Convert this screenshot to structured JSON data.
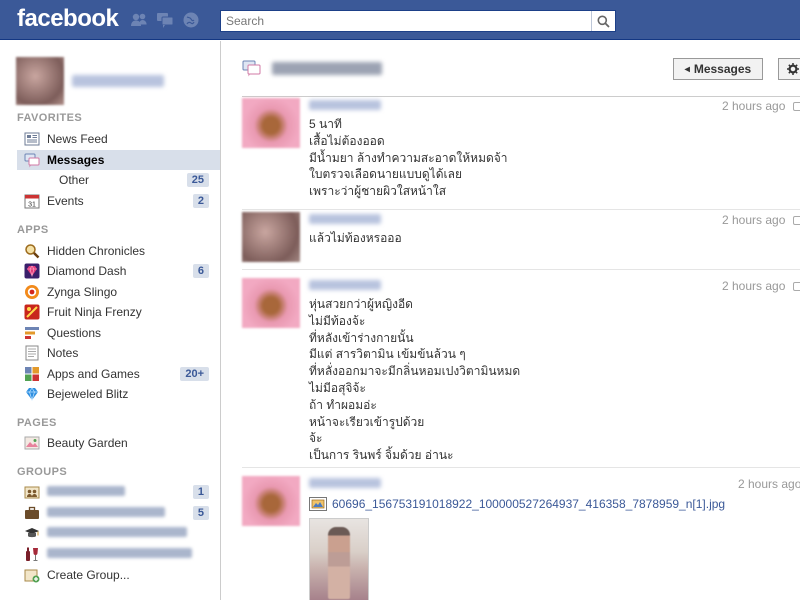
{
  "topbar": {
    "logo": "facebook",
    "search_placeholder": "Search",
    "jewels": [
      "friend-requests-icon",
      "messages-icon",
      "notifications-icon"
    ]
  },
  "sidebar": {
    "favorites_header": "FAVORITES",
    "apps_header": "APPS",
    "pages_header": "PAGES",
    "groups_header": "GROUPS",
    "favorites": [
      {
        "label": "News Feed"
      },
      {
        "label": "Messages"
      },
      {
        "label": "Other",
        "count": "25"
      },
      {
        "label": "Events",
        "count": "2"
      }
    ],
    "apps": [
      {
        "label": "Hidden Chronicles"
      },
      {
        "label": "Diamond Dash",
        "count": "6"
      },
      {
        "label": "Zynga Slingo"
      },
      {
        "label": "Fruit Ninja Frenzy"
      },
      {
        "label": "Questions"
      },
      {
        "label": "Notes"
      },
      {
        "label": "Apps and Games",
        "count": "20+"
      },
      {
        "label": "Bejeweled Blitz"
      }
    ],
    "pages": [
      {
        "label": "Beauty Garden"
      }
    ],
    "groups": [
      {
        "count": "1"
      },
      {
        "count": "5"
      },
      {},
      {},
      {
        "label": "Create Group..."
      }
    ]
  },
  "main": {
    "messages_button": "Messages",
    "messages": [
      {
        "time": "2 hours ago",
        "lines": [
          "5 นาที",
          "เสื้อไม่ต้องออด",
          "มีน้ำมยา ล้างทำความสะอาดให้หมดจ้า",
          "ใบตรวจเลือดนายแบบดูได้เลย",
          "เพราะว่าผู้ชายผิวใสหน้าใส"
        ]
      },
      {
        "time": "2 hours ago",
        "lines": [
          "แล้วไม่ท้องหรอออ"
        ]
      },
      {
        "time": "2 hours ago",
        "lines": [
          "หุ่นสวยกว่าผู้หญิงอีด",
          "ไม่มีท้องจ้ะ",
          "ที่หลังเข้าร่างกายนั้น",
          "มีแต่ สารวิตามิน เข้มข้นล้วน ๆ",
          "ที่หลั่งออกมาจะมีกลิ่นหอมเปงวิตามินหมด",
          "ไม่มีอสุจิจ้ะ",
          "ถ้า ทำผอมอ่ะ",
          "หน้าจะเรียวเข้ารูปด้วย",
          "จ้ะ",
          "เป็นการ รินพร์ จิ้มด้วย อ่านะ"
        ]
      },
      {
        "time": "2 hours ago",
        "attachment": "60696_156753191018922_100000527264937_416358_7878959_n[1].jpg"
      }
    ]
  }
}
